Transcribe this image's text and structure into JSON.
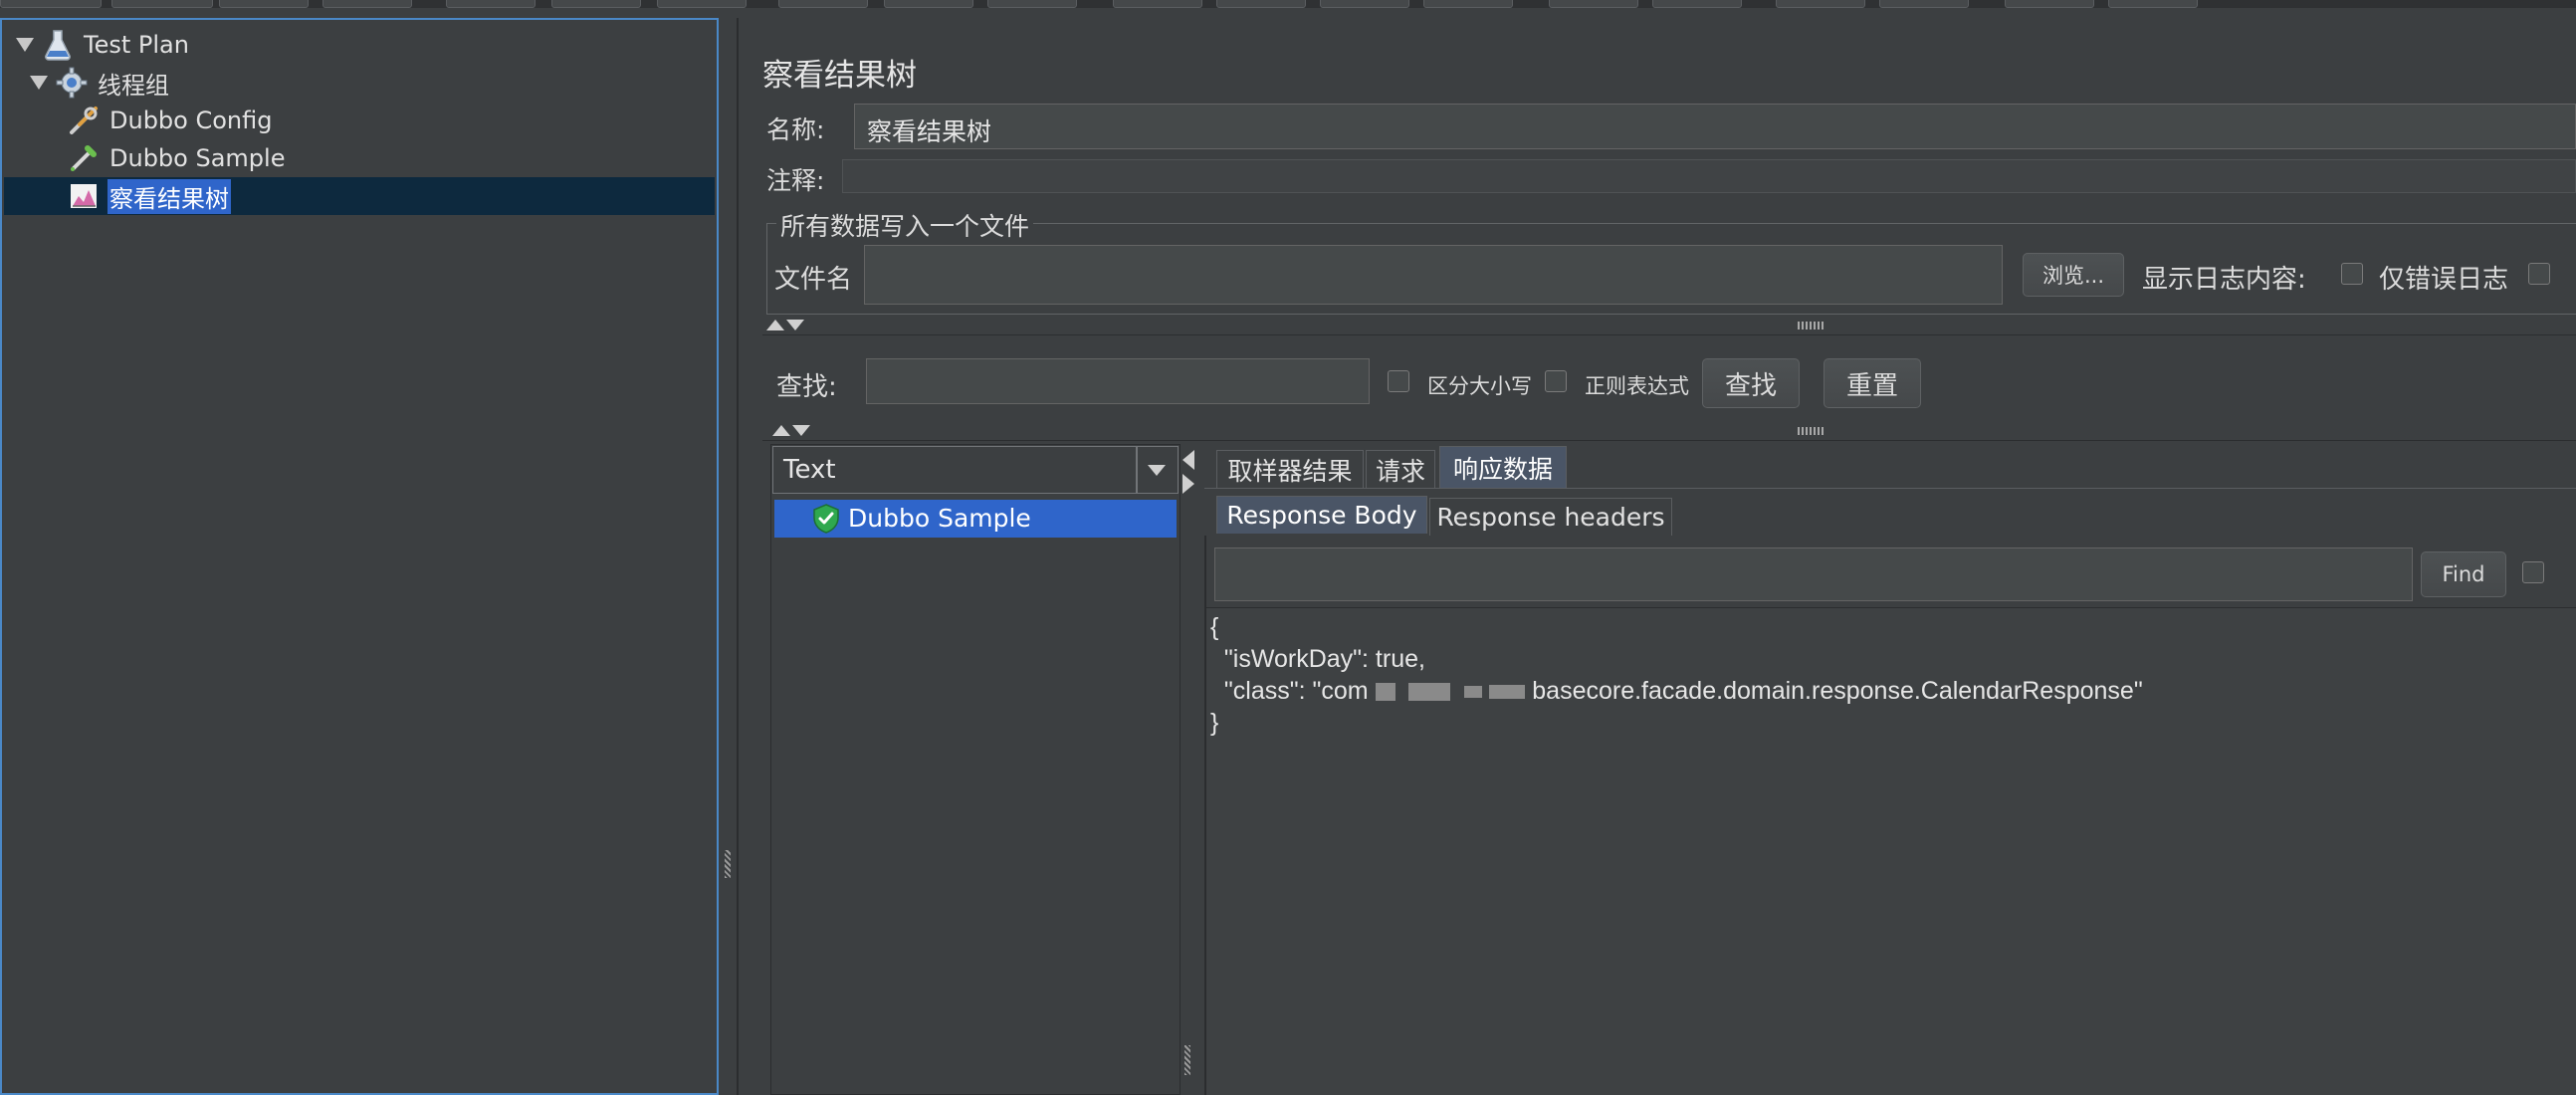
{
  "tree": {
    "items": [
      {
        "label": "Test Plan",
        "icon": "flask-icon"
      },
      {
        "label": "线程组",
        "icon": "gear-icon"
      },
      {
        "label": "Dubbo Config",
        "icon": "wrench-icon"
      },
      {
        "label": "Dubbo Sample",
        "icon": "pipette-icon"
      },
      {
        "label": "察看结果树",
        "icon": "chart-icon"
      }
    ]
  },
  "panel": {
    "title": "察看结果树",
    "name_label": "名称:",
    "name_value": "察看结果树",
    "comment_label": "注释:",
    "comment_value": "",
    "file_group_title": "所有数据写入一个文件",
    "filename_label": "文件名",
    "filename_value": "",
    "browse_button": "浏览...",
    "log_content_label": "显示日志内容:",
    "errors_only_label": "仅错误日志"
  },
  "search": {
    "label": "查找:",
    "value": "",
    "case_sensitive_label": "区分大小写",
    "regex_label": "正则表达式",
    "find_button": "查找",
    "reset_button": "重置"
  },
  "results": {
    "renderer_selected": "Text",
    "samples": [
      {
        "label": "Dubbo Sample",
        "status": "success"
      }
    ],
    "tabs": [
      {
        "label": "取样器结果",
        "active": false
      },
      {
        "label": "请求",
        "active": false
      },
      {
        "label": "响应数据",
        "active": true
      }
    ],
    "subtabs": [
      {
        "label": "Response Body",
        "active": true
      },
      {
        "label": "Response headers",
        "active": false
      }
    ],
    "find_value": "",
    "find_button": "Find",
    "response_lines": [
      "{",
      "  \"isWorkDay\": true,",
      "  \"class\": \"com",
      "basecore.facade.domain.response.CalendarResponse\"",
      "}"
    ]
  },
  "colors": {
    "background": "#3c3f41",
    "selection": "#2f65ca",
    "tree_selected_row": "#0d293e",
    "focus_border": "#4a88c7",
    "success": "#2fa84f"
  }
}
